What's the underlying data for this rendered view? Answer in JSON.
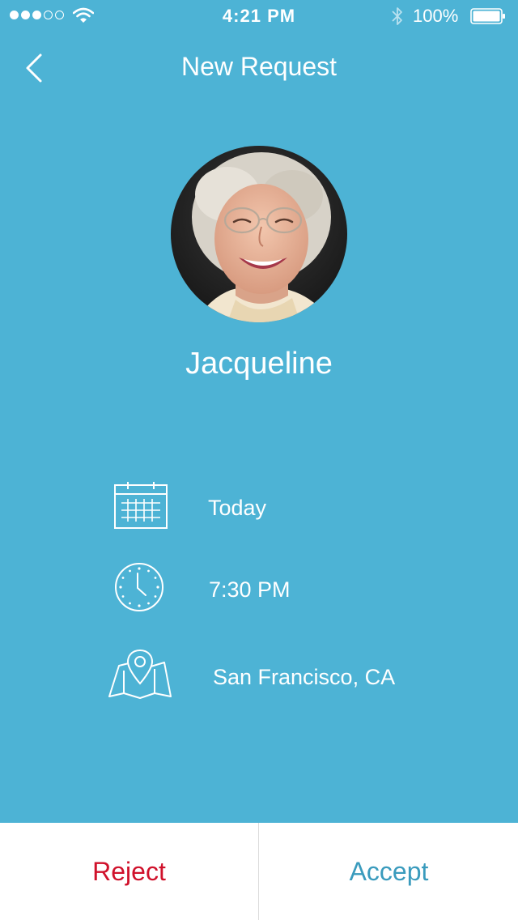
{
  "status_bar": {
    "time": "4:21 PM",
    "battery_percent": "100%",
    "signal_bars_filled": 3,
    "signal_bars_total": 5
  },
  "nav": {
    "title": "New Request",
    "back_icon": "chevron-left-icon"
  },
  "request": {
    "name": "Jacqueline",
    "avatar": "avatar-photo",
    "details": {
      "date": {
        "icon": "calendar-icon",
        "label": "Today"
      },
      "time": {
        "icon": "clock-icon",
        "label": "7:30 PM"
      },
      "location": {
        "icon": "map-pin-icon",
        "label": "San Francisco, CA"
      }
    }
  },
  "actions": {
    "reject_label": "Reject",
    "accept_label": "Accept"
  },
  "colors": {
    "background": "#4db3d5",
    "reject": "#d0112b",
    "accept": "#3a9bbd",
    "action_bar": "#ffffff"
  }
}
